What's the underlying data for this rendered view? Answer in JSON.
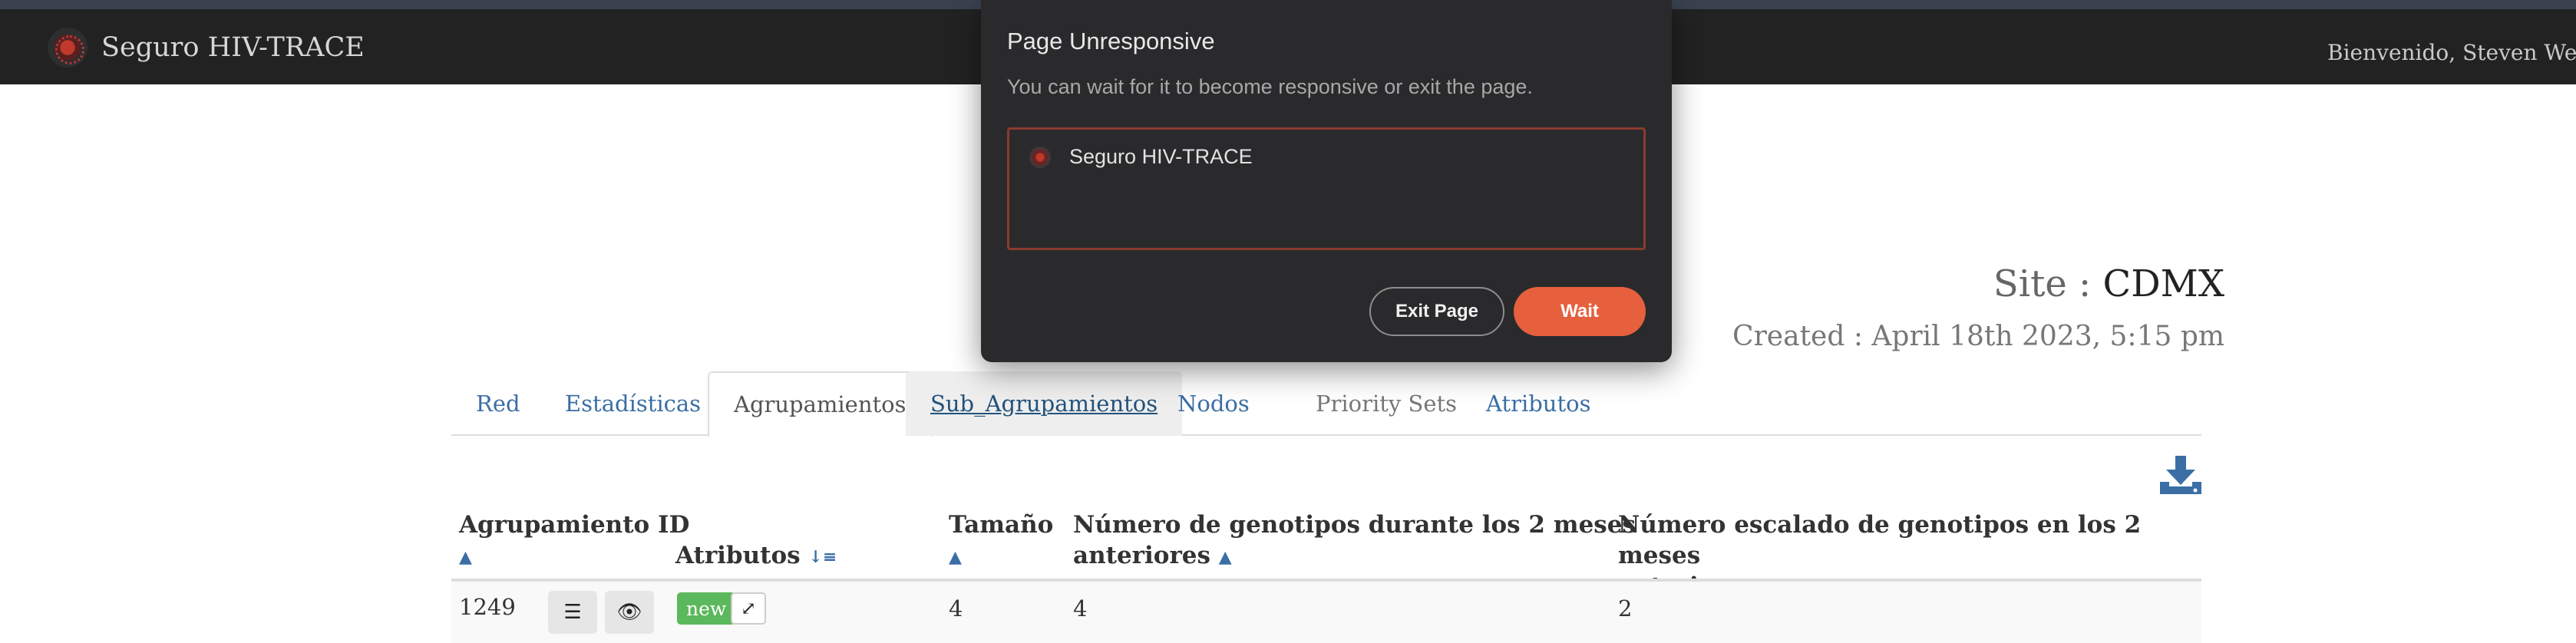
{
  "navbar": {
    "brand": "Seguro HIV-TRACE",
    "welcome": "Bienvenido, Steven Weave"
  },
  "site": {
    "label": "Site : ",
    "name": "CDMX",
    "created": "Created : April 18th 2023, 5:15 pm"
  },
  "tabs": [
    {
      "label": "Red"
    },
    {
      "label": "Estadísticas"
    },
    {
      "label": "Agrupamientos"
    },
    {
      "label": "Sub_Agrupamientos"
    },
    {
      "label": "Nodos"
    },
    {
      "label": "Priority Sets"
    },
    {
      "label": "Atributos"
    }
  ],
  "table": {
    "headers": {
      "id": "Agrupamiento ID",
      "atributos": "Atributos",
      "tamano": "Tamaño",
      "numero_line1": "Número de genotipos durante los 2 meses",
      "numero_line2": "anteriores",
      "escalado_line1": "Número escalado de genotipos en los 2 meses",
      "escalado_line2": "anteriores"
    },
    "rows": [
      {
        "id": "1249",
        "badge": "new",
        "tamano": "4",
        "numero": "4",
        "escalado": "2"
      }
    ]
  },
  "dialog": {
    "title": "Page Unresponsive",
    "message": "You can wait for it to become responsive or exit the page.",
    "item": "Seguro HIV-TRACE",
    "exit_label": "Exit Page",
    "wait_label": "Wait"
  },
  "colors": {
    "navbar": "#222222",
    "link": "#3b6ea5",
    "badge_new": "#5cb85c",
    "wait_button": "#e6603e",
    "dialog_bg": "#2a2a2c"
  },
  "icons": {
    "download": "download-icon",
    "list": "list-icon",
    "eye": "eye-icon",
    "expand": "expand-icon",
    "sort": "sort-icon"
  }
}
